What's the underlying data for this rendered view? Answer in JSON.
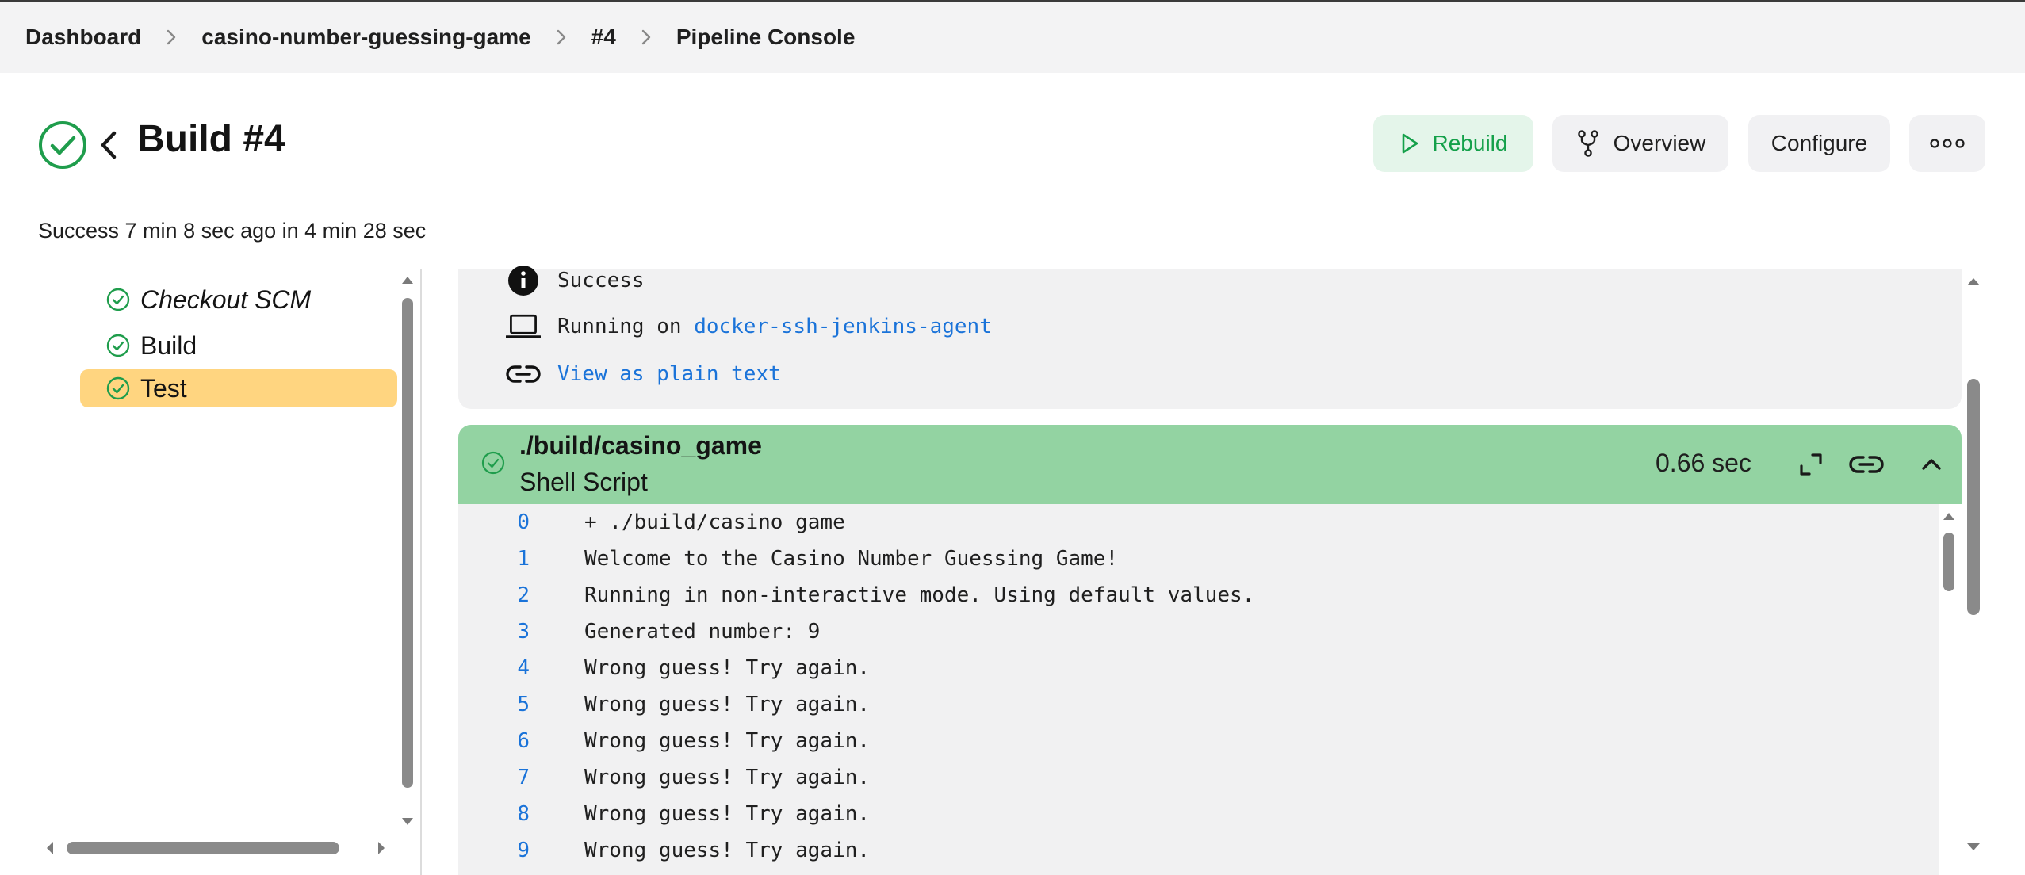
{
  "breadcrumb": [
    "Dashboard",
    "casino-number-guessing-game",
    "#4",
    "Pipeline Console"
  ],
  "header": {
    "title": "Build #4",
    "status": "Success 7 min 8 sec ago in 4 min 28 sec"
  },
  "actions": {
    "rebuild": "Rebuild",
    "overview": "Overview",
    "configure": "Configure"
  },
  "stages": [
    {
      "label": "Checkout SCM",
      "selected": false
    },
    {
      "label": "Build",
      "selected": false
    },
    {
      "label": "Test",
      "selected": true
    }
  ],
  "info": {
    "status": "Success",
    "running_on_prefix": "Running on ",
    "agent": "docker-ssh-jenkins-agent",
    "plain_text_link": "View as plain text"
  },
  "step": {
    "title": "./build/casino_game",
    "subtitle": "Shell Script",
    "duration": "0.66 sec"
  },
  "log_lines": [
    {
      "n": "0",
      "text": "+ ./build/casino_game"
    },
    {
      "n": "1",
      "text": "Welcome to the Casino Number Guessing Game!"
    },
    {
      "n": "2",
      "text": "Running in non-interactive mode. Using default values."
    },
    {
      "n": "3",
      "text": "Generated number: 9"
    },
    {
      "n": "4",
      "text": "Wrong guess! Try again."
    },
    {
      "n": "5",
      "text": "Wrong guess! Try again."
    },
    {
      "n": "6",
      "text": "Wrong guess! Try again."
    },
    {
      "n": "7",
      "text": "Wrong guess! Try again."
    },
    {
      "n": "8",
      "text": "Wrong guess! Try again."
    },
    {
      "n": "9",
      "text": "Wrong guess! Try again."
    }
  ],
  "colors": {
    "success_green": "#1f9d4c",
    "selected_stage": "#ffd580",
    "step_header": "#93d3a2",
    "link_blue": "#1a73d9"
  }
}
